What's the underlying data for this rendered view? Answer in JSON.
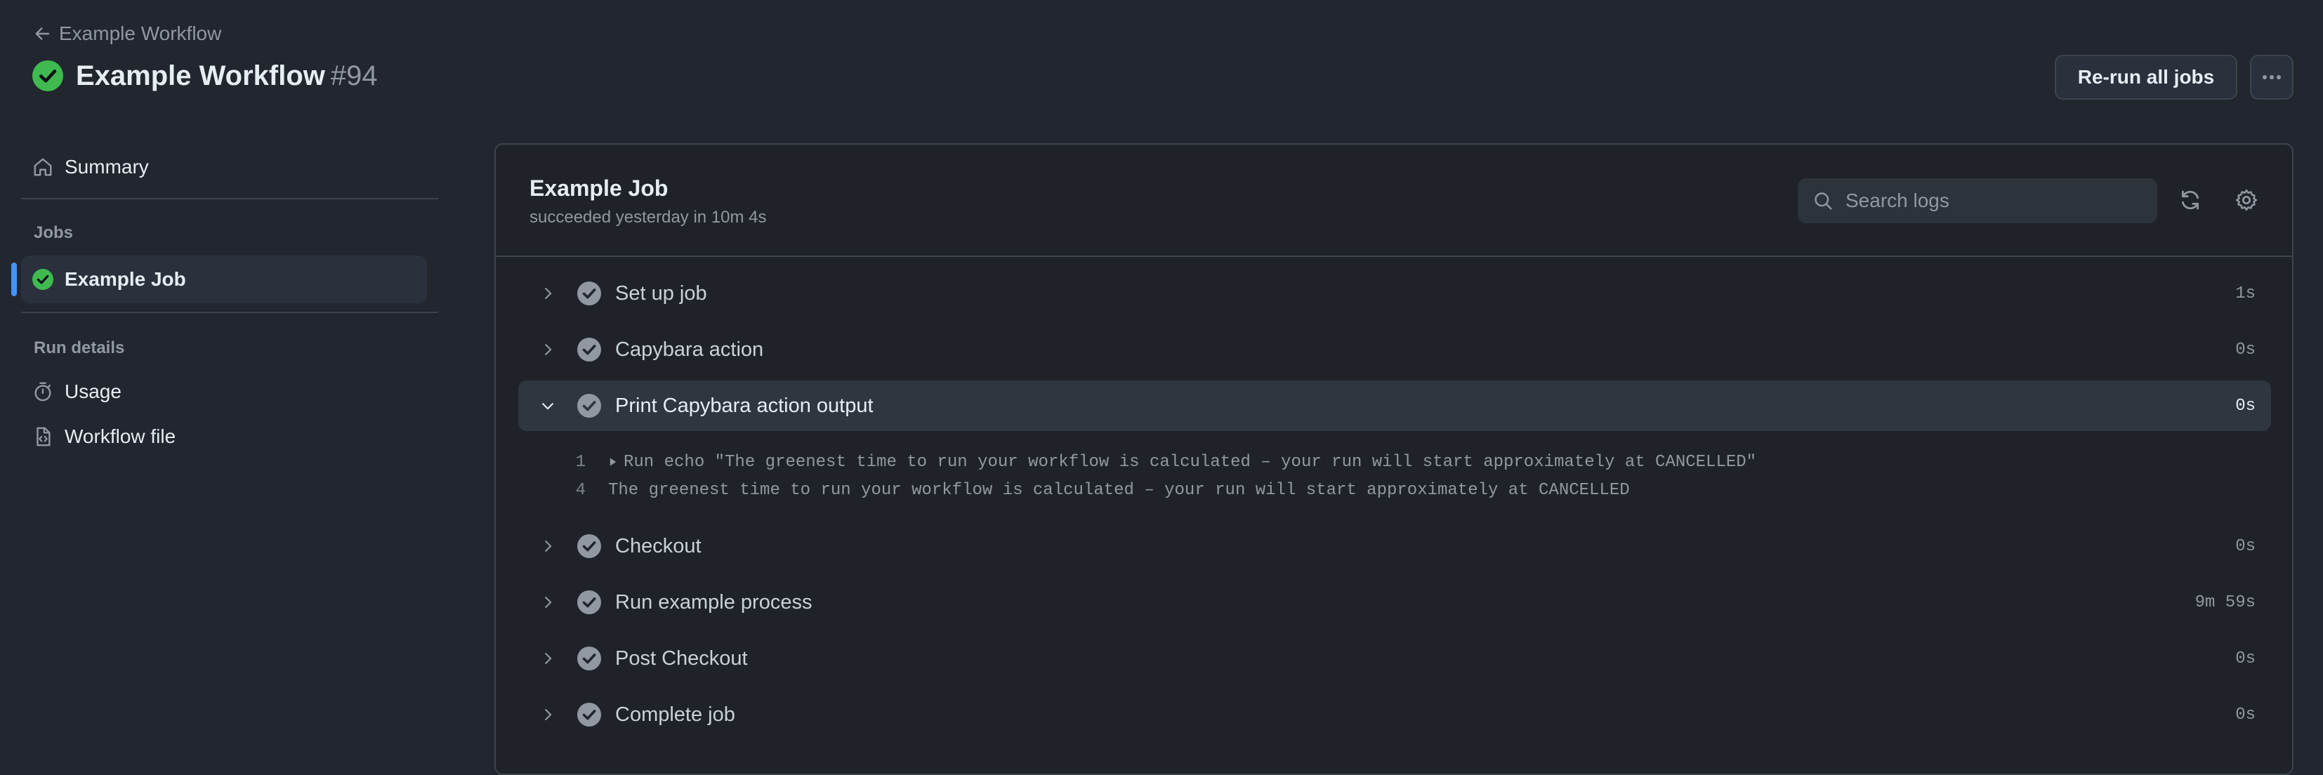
{
  "header": {
    "back_label": "Example Workflow",
    "title": "Example Workflow",
    "run_number": "#94",
    "rerun_label": "Re-run all jobs",
    "more_label": "···"
  },
  "sidebar": {
    "summary_label": "Summary",
    "jobs_heading": "Jobs",
    "job_label": "Example Job",
    "run_details_heading": "Run details",
    "usage_label": "Usage",
    "workflow_file_label": "Workflow file"
  },
  "job": {
    "title": "Example Job",
    "subtitle": "succeeded yesterday in 10m 4s",
    "search_placeholder": "Search logs"
  },
  "steps": [
    {
      "label": "Set up job",
      "duration": "1s"
    },
    {
      "label": "Capybara action",
      "duration": "0s"
    },
    {
      "label": "Print Capybara action output",
      "duration": "0s"
    },
    {
      "label": "Checkout",
      "duration": "0s"
    },
    {
      "label": "Run example process",
      "duration": "9m 59s"
    },
    {
      "label": "Post Checkout",
      "duration": "0s"
    },
    {
      "label": "Complete job",
      "duration": "0s"
    }
  ],
  "logs": [
    {
      "line": "1",
      "text": "Run echo \"The greenest time to run your workflow is calculated – your run will start approximately at CANCELLED\""
    },
    {
      "line": "4",
      "text": "The greenest time to run your workflow is calculated – your run will start approximately at CANCELLED"
    }
  ],
  "colors": {
    "background": "#22262e",
    "success_green": "#3fb950",
    "accent_blue": "#4493f8",
    "step_check_gray": "#9198a1"
  },
  "icons": {
    "back": "arrow-left-icon",
    "status": "check-circle-icon",
    "summary": "home-icon",
    "usage": "stopwatch-icon",
    "workflow_file": "file-code-icon",
    "search": "search-icon",
    "refresh": "sync-icon",
    "settings": "gear-icon"
  }
}
